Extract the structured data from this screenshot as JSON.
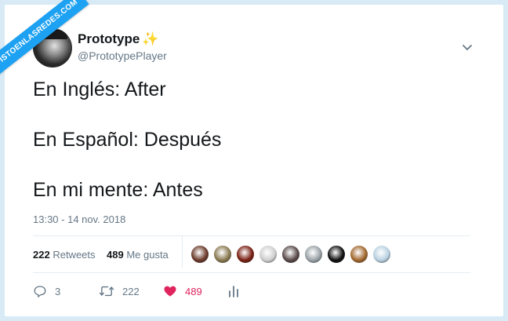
{
  "watermark": "VISTOENLASREDES.COM",
  "author": {
    "name": "Prototype",
    "badge": "✨",
    "handle": "@PrototypePlayer"
  },
  "tweet": {
    "lines": [
      "En Inglés: After",
      "En Español: Después",
      "En mi mente: Antes"
    ],
    "timestamp": "13:30 - 14 nov. 2018"
  },
  "stats": {
    "retweets_count": "222",
    "retweets_label": "Retweets",
    "likes_count": "489",
    "likes_label": "Me gusta"
  },
  "liker_colors": [
    "#6b3a2a",
    "#8a7a52",
    "#7a1f12",
    "#cfcfcf",
    "#5a4a4a",
    "#9aa3a8",
    "#0f0f0f",
    "#a2682f",
    "#b9d1e2"
  ],
  "actions": {
    "reply_count": "3",
    "retweet_count": "222",
    "like_count": "489"
  },
  "colors": {
    "accent": "#1da1f2",
    "like": "#e0245e",
    "muted": "#657786"
  }
}
